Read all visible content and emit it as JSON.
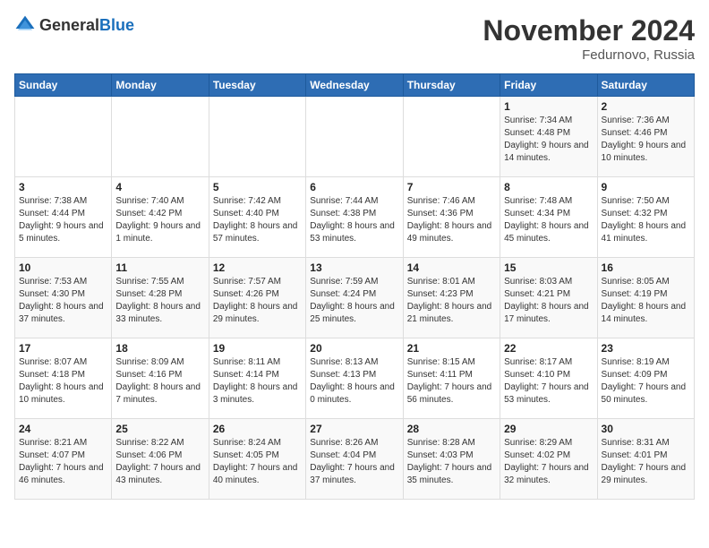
{
  "logo": {
    "general": "General",
    "blue": "Blue"
  },
  "title": "November 2024",
  "location": "Fedurnovo, Russia",
  "days_of_week": [
    "Sunday",
    "Monday",
    "Tuesday",
    "Wednesday",
    "Thursday",
    "Friday",
    "Saturday"
  ],
  "weeks": [
    [
      {
        "day": "",
        "info": ""
      },
      {
        "day": "",
        "info": ""
      },
      {
        "day": "",
        "info": ""
      },
      {
        "day": "",
        "info": ""
      },
      {
        "day": "",
        "info": ""
      },
      {
        "day": "1",
        "info": "Sunrise: 7:34 AM\nSunset: 4:48 PM\nDaylight: 9 hours and 14 minutes."
      },
      {
        "day": "2",
        "info": "Sunrise: 7:36 AM\nSunset: 4:46 PM\nDaylight: 9 hours and 10 minutes."
      }
    ],
    [
      {
        "day": "3",
        "info": "Sunrise: 7:38 AM\nSunset: 4:44 PM\nDaylight: 9 hours and 5 minutes."
      },
      {
        "day": "4",
        "info": "Sunrise: 7:40 AM\nSunset: 4:42 PM\nDaylight: 9 hours and 1 minute."
      },
      {
        "day": "5",
        "info": "Sunrise: 7:42 AM\nSunset: 4:40 PM\nDaylight: 8 hours and 57 minutes."
      },
      {
        "day": "6",
        "info": "Sunrise: 7:44 AM\nSunset: 4:38 PM\nDaylight: 8 hours and 53 minutes."
      },
      {
        "day": "7",
        "info": "Sunrise: 7:46 AM\nSunset: 4:36 PM\nDaylight: 8 hours and 49 minutes."
      },
      {
        "day": "8",
        "info": "Sunrise: 7:48 AM\nSunset: 4:34 PM\nDaylight: 8 hours and 45 minutes."
      },
      {
        "day": "9",
        "info": "Sunrise: 7:50 AM\nSunset: 4:32 PM\nDaylight: 8 hours and 41 minutes."
      }
    ],
    [
      {
        "day": "10",
        "info": "Sunrise: 7:53 AM\nSunset: 4:30 PM\nDaylight: 8 hours and 37 minutes."
      },
      {
        "day": "11",
        "info": "Sunrise: 7:55 AM\nSunset: 4:28 PM\nDaylight: 8 hours and 33 minutes."
      },
      {
        "day": "12",
        "info": "Sunrise: 7:57 AM\nSunset: 4:26 PM\nDaylight: 8 hours and 29 minutes."
      },
      {
        "day": "13",
        "info": "Sunrise: 7:59 AM\nSunset: 4:24 PM\nDaylight: 8 hours and 25 minutes."
      },
      {
        "day": "14",
        "info": "Sunrise: 8:01 AM\nSunset: 4:23 PM\nDaylight: 8 hours and 21 minutes."
      },
      {
        "day": "15",
        "info": "Sunrise: 8:03 AM\nSunset: 4:21 PM\nDaylight: 8 hours and 17 minutes."
      },
      {
        "day": "16",
        "info": "Sunrise: 8:05 AM\nSunset: 4:19 PM\nDaylight: 8 hours and 14 minutes."
      }
    ],
    [
      {
        "day": "17",
        "info": "Sunrise: 8:07 AM\nSunset: 4:18 PM\nDaylight: 8 hours and 10 minutes."
      },
      {
        "day": "18",
        "info": "Sunrise: 8:09 AM\nSunset: 4:16 PM\nDaylight: 8 hours and 7 minutes."
      },
      {
        "day": "19",
        "info": "Sunrise: 8:11 AM\nSunset: 4:14 PM\nDaylight: 8 hours and 3 minutes."
      },
      {
        "day": "20",
        "info": "Sunrise: 8:13 AM\nSunset: 4:13 PM\nDaylight: 8 hours and 0 minutes."
      },
      {
        "day": "21",
        "info": "Sunrise: 8:15 AM\nSunset: 4:11 PM\nDaylight: 7 hours and 56 minutes."
      },
      {
        "day": "22",
        "info": "Sunrise: 8:17 AM\nSunset: 4:10 PM\nDaylight: 7 hours and 53 minutes."
      },
      {
        "day": "23",
        "info": "Sunrise: 8:19 AM\nSunset: 4:09 PM\nDaylight: 7 hours and 50 minutes."
      }
    ],
    [
      {
        "day": "24",
        "info": "Sunrise: 8:21 AM\nSunset: 4:07 PM\nDaylight: 7 hours and 46 minutes."
      },
      {
        "day": "25",
        "info": "Sunrise: 8:22 AM\nSunset: 4:06 PM\nDaylight: 7 hours and 43 minutes."
      },
      {
        "day": "26",
        "info": "Sunrise: 8:24 AM\nSunset: 4:05 PM\nDaylight: 7 hours and 40 minutes."
      },
      {
        "day": "27",
        "info": "Sunrise: 8:26 AM\nSunset: 4:04 PM\nDaylight: 7 hours and 37 minutes."
      },
      {
        "day": "28",
        "info": "Sunrise: 8:28 AM\nSunset: 4:03 PM\nDaylight: 7 hours and 35 minutes."
      },
      {
        "day": "29",
        "info": "Sunrise: 8:29 AM\nSunset: 4:02 PM\nDaylight: 7 hours and 32 minutes."
      },
      {
        "day": "30",
        "info": "Sunrise: 8:31 AM\nSunset: 4:01 PM\nDaylight: 7 hours and 29 minutes."
      }
    ]
  ]
}
